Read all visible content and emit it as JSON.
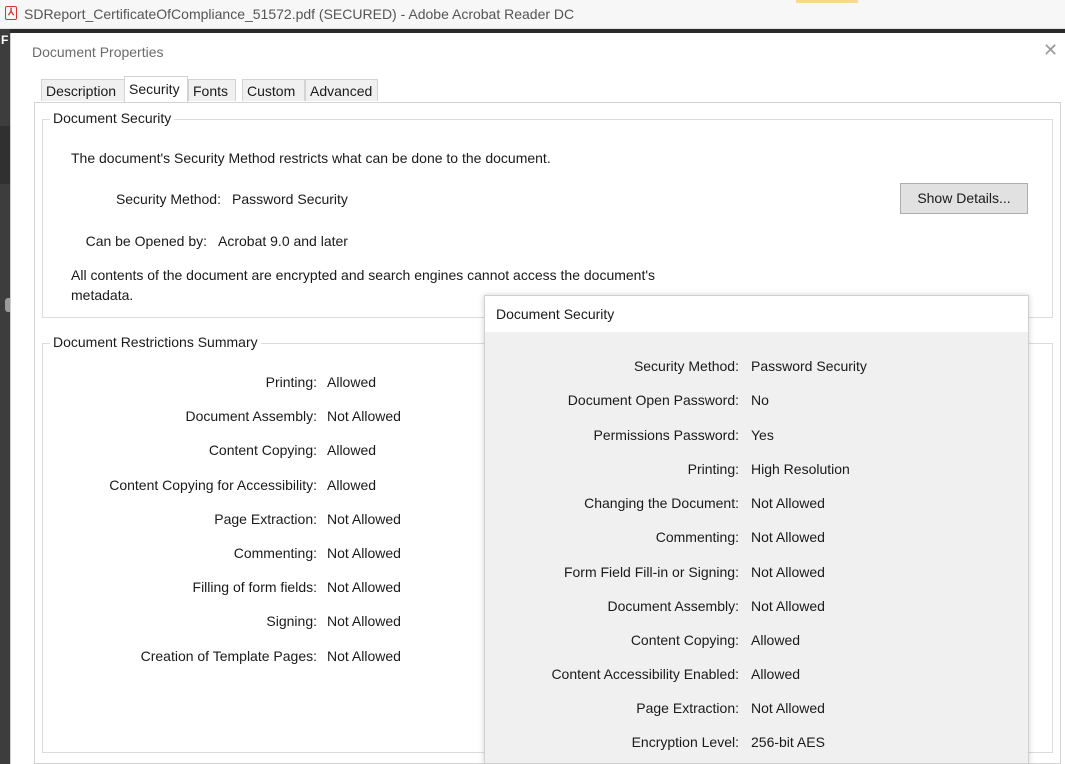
{
  "app": {
    "icon": "pdf-icon",
    "title": "SDReport_CertificateOfCompliance_51572.pdf (SECURED) - Adobe Acrobat Reader DC",
    "strip_letter": "F"
  },
  "dialog": {
    "title": "Document Properties",
    "close_icon": "close-icon",
    "tabs": [
      {
        "label": "Description",
        "active": false
      },
      {
        "label": "Security",
        "active": true
      },
      {
        "label": "Fonts",
        "active": false
      },
      {
        "label": "Custom",
        "active": false
      },
      {
        "label": "Advanced",
        "active": false
      }
    ]
  },
  "document_security": {
    "legend": "Document Security",
    "intro": "The document's Security Method restricts what can be done to the document.",
    "method_label": "Security Method:",
    "method_value": "Password Security",
    "show_details": "Show Details...",
    "opened_label": "Can be Opened by:",
    "opened_value": "Acrobat 9.0 and later",
    "encryption_note_line1": "All contents of the document are encrypted and search engines cannot access the document's",
    "encryption_note_line2": "metadata."
  },
  "restrictions": {
    "legend": "Document Restrictions Summary",
    "rows": [
      {
        "label": "Printing:",
        "value": "Allowed"
      },
      {
        "label": "Document Assembly:",
        "value": "Not Allowed"
      },
      {
        "label": "Content Copying:",
        "value": "Allowed"
      },
      {
        "label": "Content Copying for Accessibility:",
        "value": "Allowed"
      },
      {
        "label": "Page Extraction:",
        "value": "Not Allowed"
      },
      {
        "label": "Commenting:",
        "value": "Not Allowed"
      },
      {
        "label": "Filling of form fields:",
        "value": "Not Allowed"
      },
      {
        "label": "Signing:",
        "value": "Not Allowed"
      },
      {
        "label": "Creation of Template Pages:",
        "value": "Not Allowed"
      }
    ]
  },
  "popup": {
    "title": "Document Security",
    "rows": [
      {
        "label": "Security Method:",
        "value": "Password Security"
      },
      {
        "label": "Document Open Password:",
        "value": "No"
      },
      {
        "label": "Permissions Password:",
        "value": "Yes"
      },
      {
        "label": "Printing:",
        "value": "High Resolution"
      },
      {
        "label": "Changing the Document:",
        "value": "Not Allowed"
      },
      {
        "label": "Commenting:",
        "value": "Not Allowed"
      },
      {
        "label": "Form Field Fill-in or Signing:",
        "value": "Not Allowed"
      },
      {
        "label": "Document Assembly:",
        "value": "Not Allowed"
      },
      {
        "label": "Content Copying:",
        "value": "Allowed"
      },
      {
        "label": "Content Accessibility Enabled:",
        "value": "Allowed"
      },
      {
        "label": "Page Extraction:",
        "value": "Not Allowed"
      },
      {
        "label": "Encryption Level:",
        "value": "256-bit AES"
      }
    ]
  }
}
